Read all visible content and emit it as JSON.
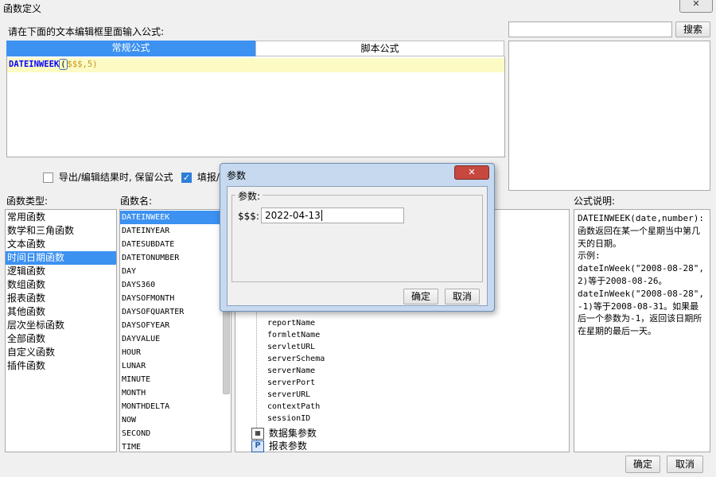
{
  "window": {
    "title": "函数定义"
  },
  "editor": {
    "prompt": "请在下面的文本编辑框里面输入公式:",
    "tabs": [
      "常规公式",
      "脚本公式"
    ],
    "formula_fn": "DATEINWEEK",
    "formula_paren": "(",
    "formula_args": "$$$,5)",
    "preserve_label": "导出/编辑结果时, 保留公式",
    "fill_label": "填报/"
  },
  "search": {
    "value": "",
    "button": "搜索"
  },
  "categories": {
    "header": "函数类型:",
    "items": [
      "常用函数",
      "数学和三角函数",
      "文本函数",
      "时间日期函数",
      "逻辑函数",
      "数组函数",
      "报表函数",
      "其他函数",
      "层次坐标函数",
      "全部函数",
      "自定义函数",
      "插件函数"
    ],
    "selected_index": 3
  },
  "functions": {
    "header": "函数名:",
    "items": [
      "DATEINWEEK",
      "DATEINYEAR",
      "DATESUBDATE",
      "DATETONUMBER",
      "DAY",
      "DAYS360",
      "DAYSOFMONTH",
      "DAYSOFQUARTER",
      "DAYSOFYEAR",
      "DAYVALUE",
      "HOUR",
      "LUNAR",
      "MINUTE",
      "MONTH",
      "MONTHDELTA",
      "NOW",
      "SECOND",
      "TIME"
    ],
    "selected_index": 0
  },
  "params_tree": {
    "items": [
      "reportName",
      "formletName",
      "servletURL",
      "serverSchema",
      "serverName",
      "serverPort",
      "serverURL",
      "contextPath",
      "sessionID"
    ],
    "dataset_params": "数据集参数",
    "report_params": "报表参数",
    "dataset_icon": "dataset-param-icon",
    "report_icon_letter": "P"
  },
  "description": {
    "header": "公式说明:",
    "text": "DATEINWEEK(date,number):函数返回在某一个星期当中第几天的日期。\n示例:\ndateInWeek(\"2008-08-28\",2)等于2008-08-26。\ndateInWeek(\"2008-08-28\",-1)等于2008-08-31。如果最后一个参数为-1，返回该日期所在星期的最后一天。"
  },
  "dialog": {
    "title": "参数",
    "group": "参数:",
    "field_label": "$$$:",
    "field_value": "2022-04-13",
    "ok": "确定",
    "cancel": "取消"
  },
  "footer": {
    "ok": "确定",
    "cancel": "取消"
  },
  "colors": {
    "accent": "#3c91f1",
    "formula_bg": "#fdfbc4",
    "fn_name": "#0000ff",
    "args": "#c8961e",
    "dialog_frame": "#c6d9ef"
  }
}
